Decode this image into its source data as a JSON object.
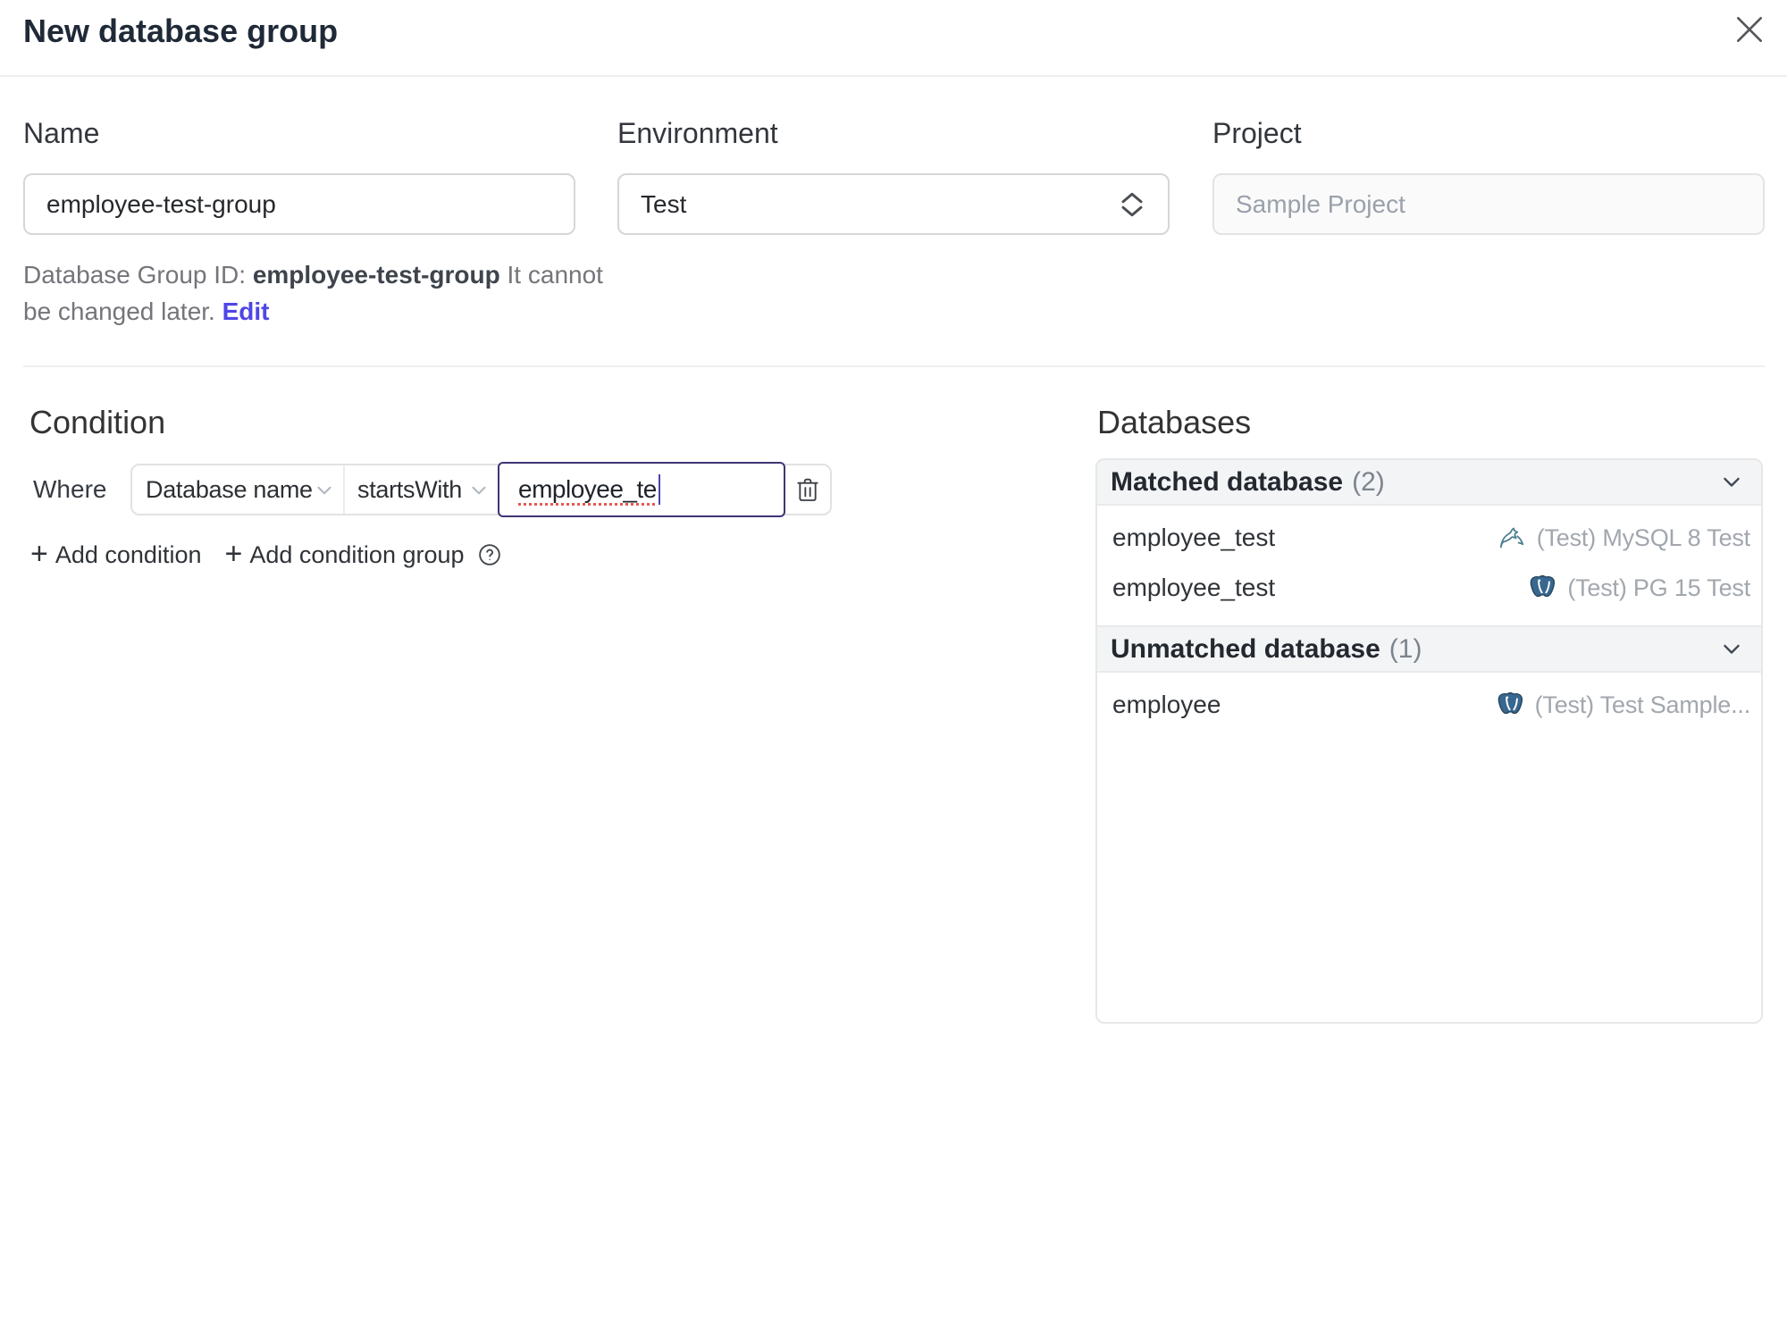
{
  "header": {
    "title": "New database group"
  },
  "form": {
    "name": {
      "label": "Name",
      "value": "employee-test-group"
    },
    "environment": {
      "label": "Environment",
      "value": "Test"
    },
    "project": {
      "label": "Project",
      "value": "Sample Project"
    },
    "helper": {
      "prefix": "Database Group ID: ",
      "id": "employee-test-group",
      "note": " It cannot be changed later. ",
      "edit_link": "Edit"
    }
  },
  "condition": {
    "heading": "Condition",
    "where_label": "Where",
    "field_select": "Database name",
    "operator_select": "startsWith",
    "value_input": "employee_te",
    "add_condition": "Add condition",
    "add_condition_group": "Add condition group"
  },
  "databases": {
    "heading": "Databases",
    "groups": [
      {
        "title": "Matched database",
        "count": "(2)",
        "rows": [
          {
            "name": "employee_test",
            "engine": "mysql",
            "info": "(Test) MySQL 8 Test"
          },
          {
            "name": "employee_test",
            "engine": "postgres",
            "info": "(Test) PG 15 Test"
          }
        ]
      },
      {
        "title": "Unmatched database",
        "count": "(1)",
        "rows": [
          {
            "name": "employee",
            "engine": "postgres",
            "info": "(Test) Test Sample..."
          }
        ]
      }
    ]
  },
  "colors": {
    "accent": "#4f46e5",
    "focus_border": "#3f3575",
    "header_bg": "#f2f4f6",
    "mysql_icon": "#4e7a8a",
    "postgres_icon": "#336791"
  }
}
